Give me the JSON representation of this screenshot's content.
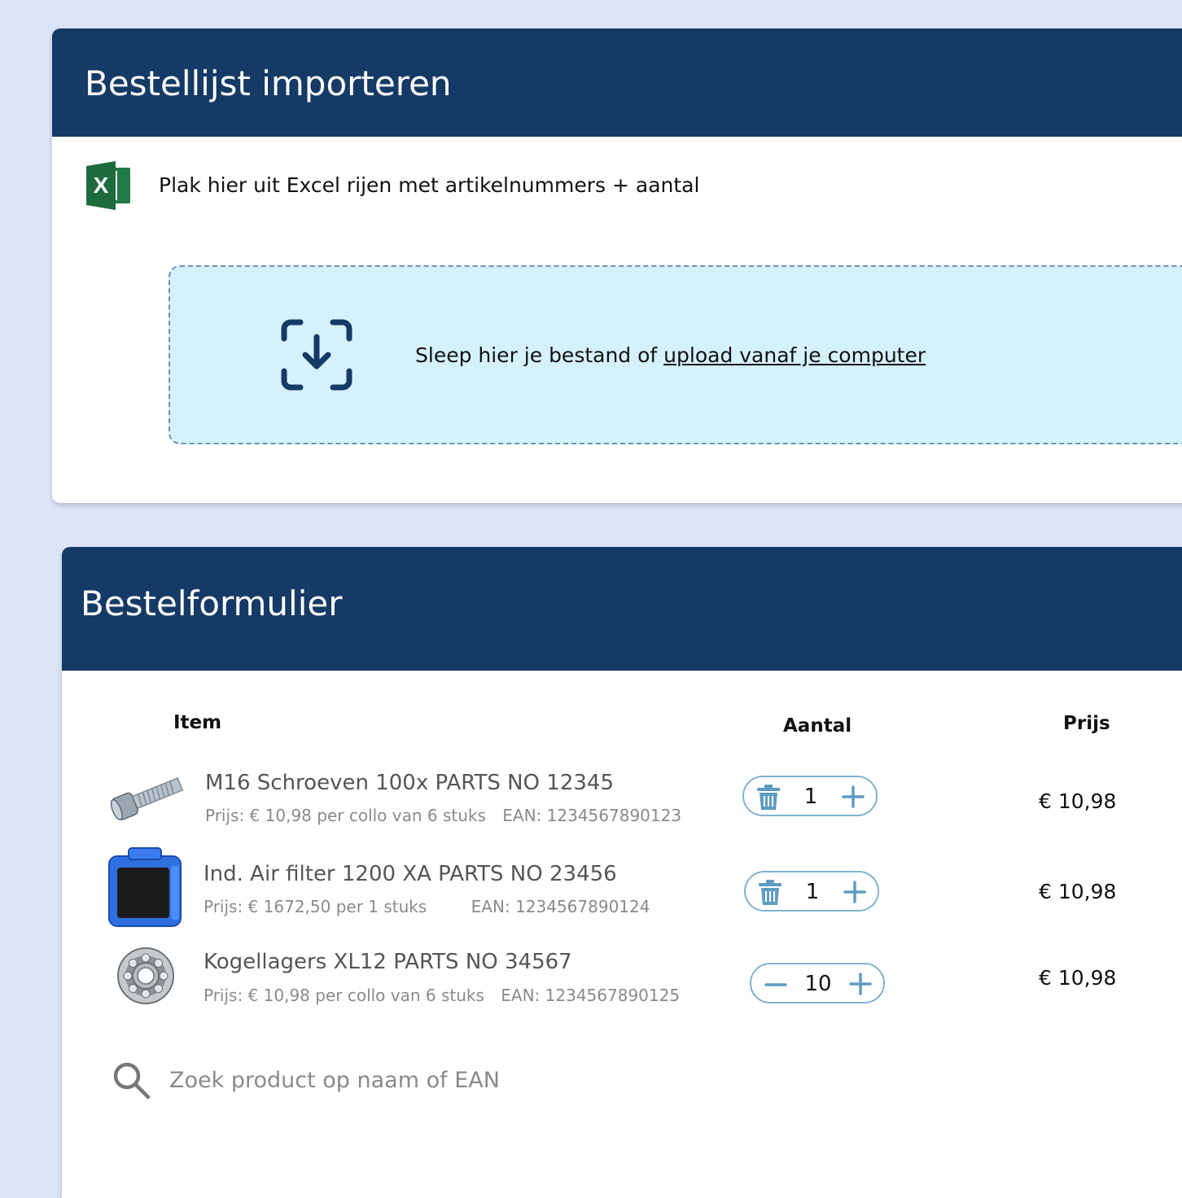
{
  "import_card": {
    "title": "Bestellijst importeren",
    "instruction": "Plak hier uit Excel rijen met artikelnummers + aantal",
    "dropzone": {
      "text": "Sleep hier je bestand of ",
      "link": "upload vanaf je computer"
    }
  },
  "order_card": {
    "title": "Bestelformulier",
    "columns": {
      "item": "Item",
      "quantity": "Aantal",
      "price": "Prijs"
    },
    "items": [
      {
        "name": "M16 Schroeven 100x PARTS NO 12345",
        "price_info": "Prijs: € 10,98 per collo van 6 stuks",
        "ean": "EAN: 1234567890123",
        "quantity": "1",
        "price": "€ 10,98",
        "image_icon": "screw-image",
        "left_control": "trash-icon"
      },
      {
        "name": "Ind. Air filter 1200 XA PARTS NO 23456",
        "price_info": "Prijs: € 1672,50  per 1 stuks",
        "ean": "EAN: 1234567890124",
        "quantity": "1",
        "price": "€ 10,98",
        "image_icon": "air-filter-image",
        "left_control": "trash-icon"
      },
      {
        "name": "Kogellagers XL12 PARTS NO 34567",
        "price_info": "Prijs: € 10,98 per collo van 6 stuks",
        "ean": "EAN: 1234567890125",
        "quantity": "10",
        "price": "€ 10,98",
        "image_icon": "ball-bearing-image",
        "left_control": "minus-icon"
      }
    ],
    "search": {
      "placeholder": "Zoek product op naam of EAN",
      "value": ""
    }
  },
  "colors": {
    "page_background": "#dce5f7",
    "header_background": "#163a66",
    "dropzone_background": "#d5f1fd",
    "stepper_accent": "#5f9cc0",
    "excel_green": "#1f7a45"
  }
}
